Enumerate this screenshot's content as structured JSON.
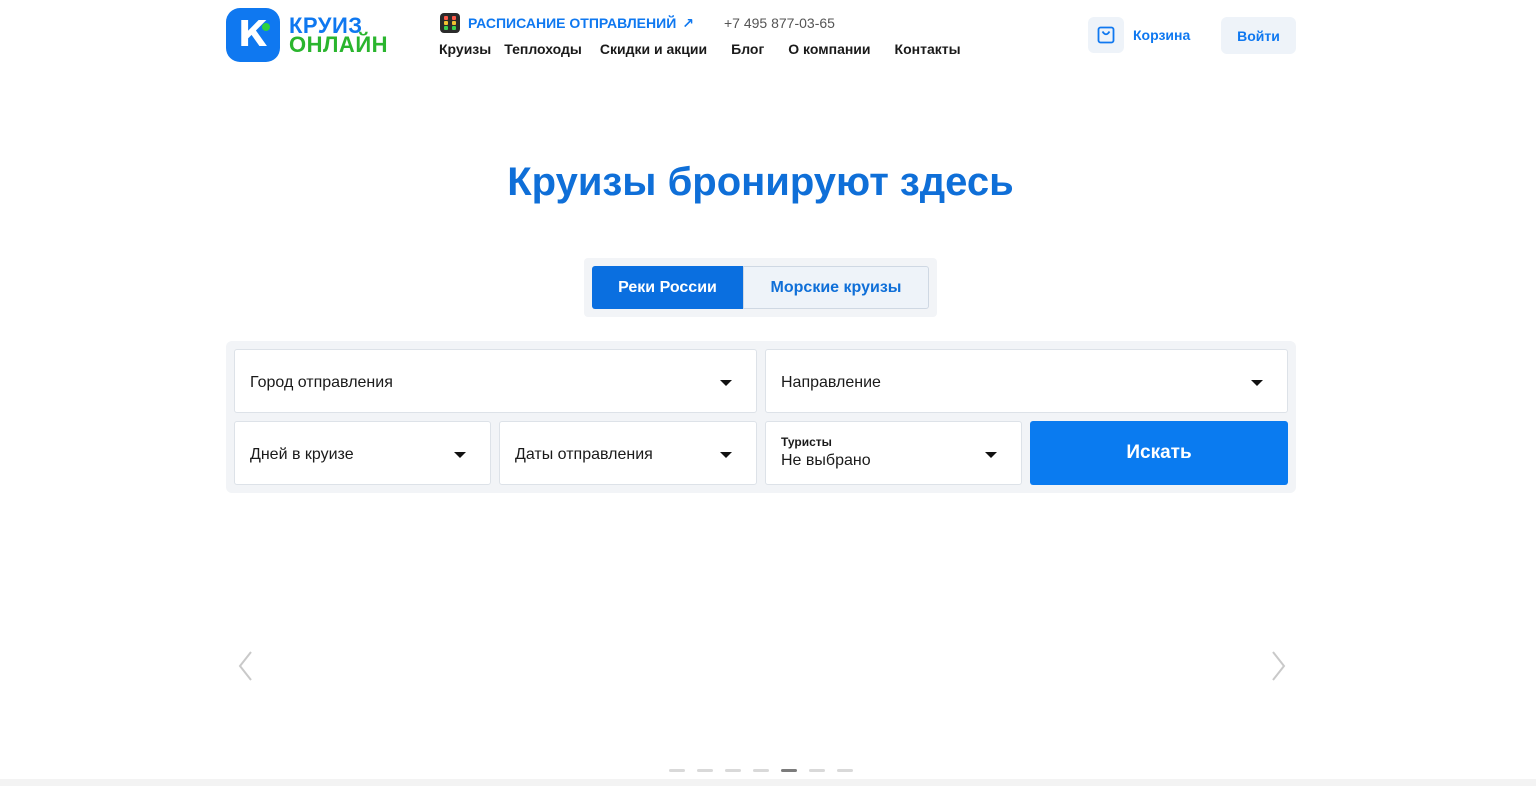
{
  "brand": {
    "logo_letter": "К",
    "name_line1": "КРУИЗ",
    "name_line2": "ОНЛАЙН",
    "primary_color": "#0f78f0",
    "accent_color": "#2ab52e"
  },
  "header": {
    "schedule_label": "РАСПИСАНИЕ ОТПРАВЛЕНИЙ",
    "schedule_arrow": "↗",
    "phone": "+7 495 877-03-65",
    "cart_label": "Корзина",
    "login_label": "Войти"
  },
  "nav": {
    "items": [
      "Круизы",
      "Теплоходы",
      "Скидки и акции",
      "Блог",
      "О компании",
      "Контакты"
    ]
  },
  "hero": {
    "title": "Круизы бронируют здесь"
  },
  "tabs": {
    "active": "Реки России",
    "inactive": "Морские круизы"
  },
  "search": {
    "city_placeholder": "Город отправления",
    "direction_placeholder": "Направление",
    "days_placeholder": "Дней в круизе",
    "dates_placeholder": "Даты отправления",
    "tourists_label": "Туристы",
    "tourists_value": "Не выбрано",
    "submit_label": "Искать"
  },
  "carousel": {
    "total_slides": 7,
    "active_slide": 5
  }
}
